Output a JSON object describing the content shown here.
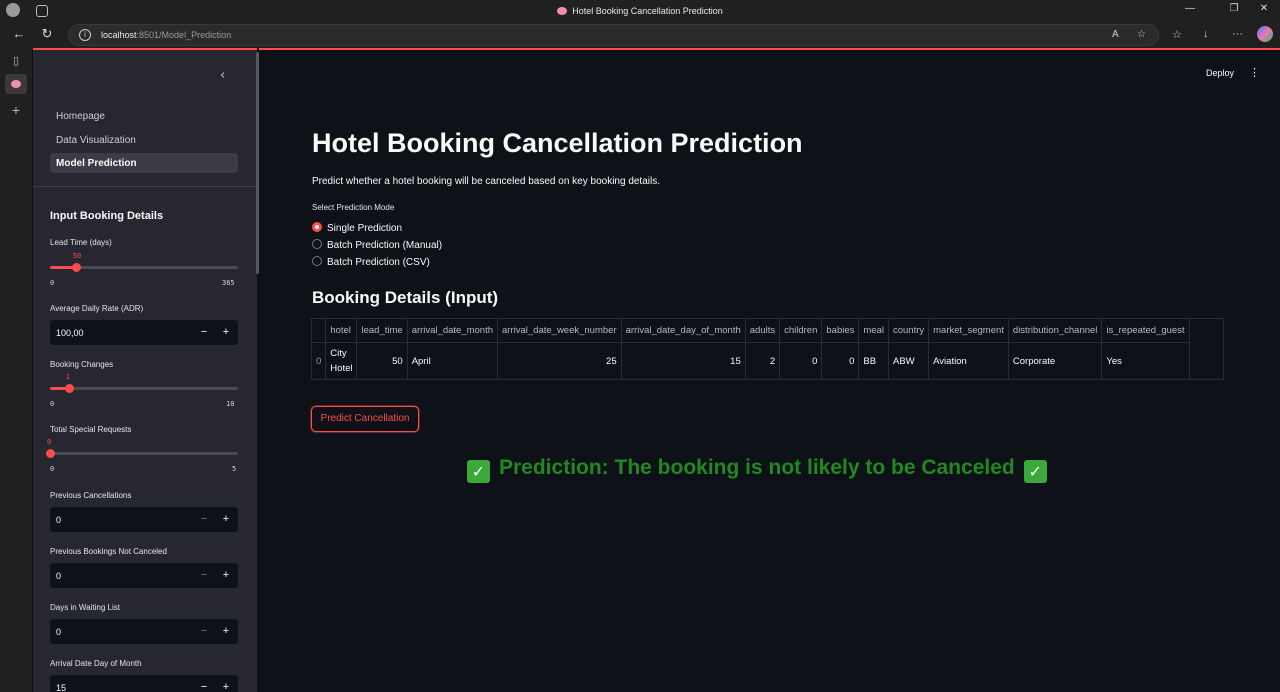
{
  "browser": {
    "window_title": "Hotel Booking Cancellation Prediction",
    "url_host": "localhost",
    "url_rest": ":8501/Model_Prediction"
  },
  "sidebar": {
    "nav": [
      "Homepage",
      "Data Visualization",
      "Model Prediction"
    ],
    "active_index": 2,
    "header": "Input Booking Details",
    "lead_time": {
      "label": "Lead Time (days)",
      "value": "50",
      "min": "0",
      "max": "365",
      "fraction": 0.137
    },
    "adr": {
      "label": "Average Daily Rate (ADR)",
      "value": "100,00",
      "minus": "−",
      "plus": "+"
    },
    "booking_changes": {
      "label": "Booking Changes",
      "value": "1",
      "min": "0",
      "max": "10",
      "fraction": 0.1
    },
    "special_requests": {
      "label": "Total Special Requests",
      "value": "0",
      "min": "0",
      "max": "5",
      "fraction": 0.0
    },
    "prev_cancellations": {
      "label": "Previous Cancellations",
      "value": "0"
    },
    "prev_not_canceled": {
      "label": "Previous Bookings Not Canceled",
      "value": "0"
    },
    "waiting_list": {
      "label": "Days in Waiting List",
      "value": "0"
    },
    "arrival_day": {
      "label": "Arrival Date Day of Month",
      "value": "15"
    }
  },
  "header": {
    "deploy": "Deploy",
    "menu": "⋮"
  },
  "main": {
    "title": "Hotel Booking Cancellation Prediction",
    "description": "Predict whether a hotel booking will be canceled based on key booking details.",
    "mode_label": "Select Prediction Mode",
    "modes": [
      "Single Prediction",
      "Batch Prediction (Manual)",
      "Batch Prediction (CSV)"
    ],
    "selected_mode": 0,
    "section_title": "Booking Details (Input)",
    "table": {
      "columns": [
        "",
        "hotel",
        "lead_time",
        "arrival_date_month",
        "arrival_date_week_number",
        "arrival_date_day_of_month",
        "adults",
        "children",
        "babies",
        "meal",
        "country",
        "market_segment",
        "distribution_channel",
        "is_repeated_guest"
      ],
      "row": [
        "0",
        "City Hotel",
        "50",
        "April",
        "25",
        "15",
        "2",
        "0",
        "0",
        "BB",
        "ABW",
        "Aviation",
        "Corporate",
        "Yes"
      ]
    },
    "predict_button": "Predict Cancellation",
    "result_text": "Prediction: The booking is not likely to be Canceled",
    "result_icon": "✓"
  }
}
